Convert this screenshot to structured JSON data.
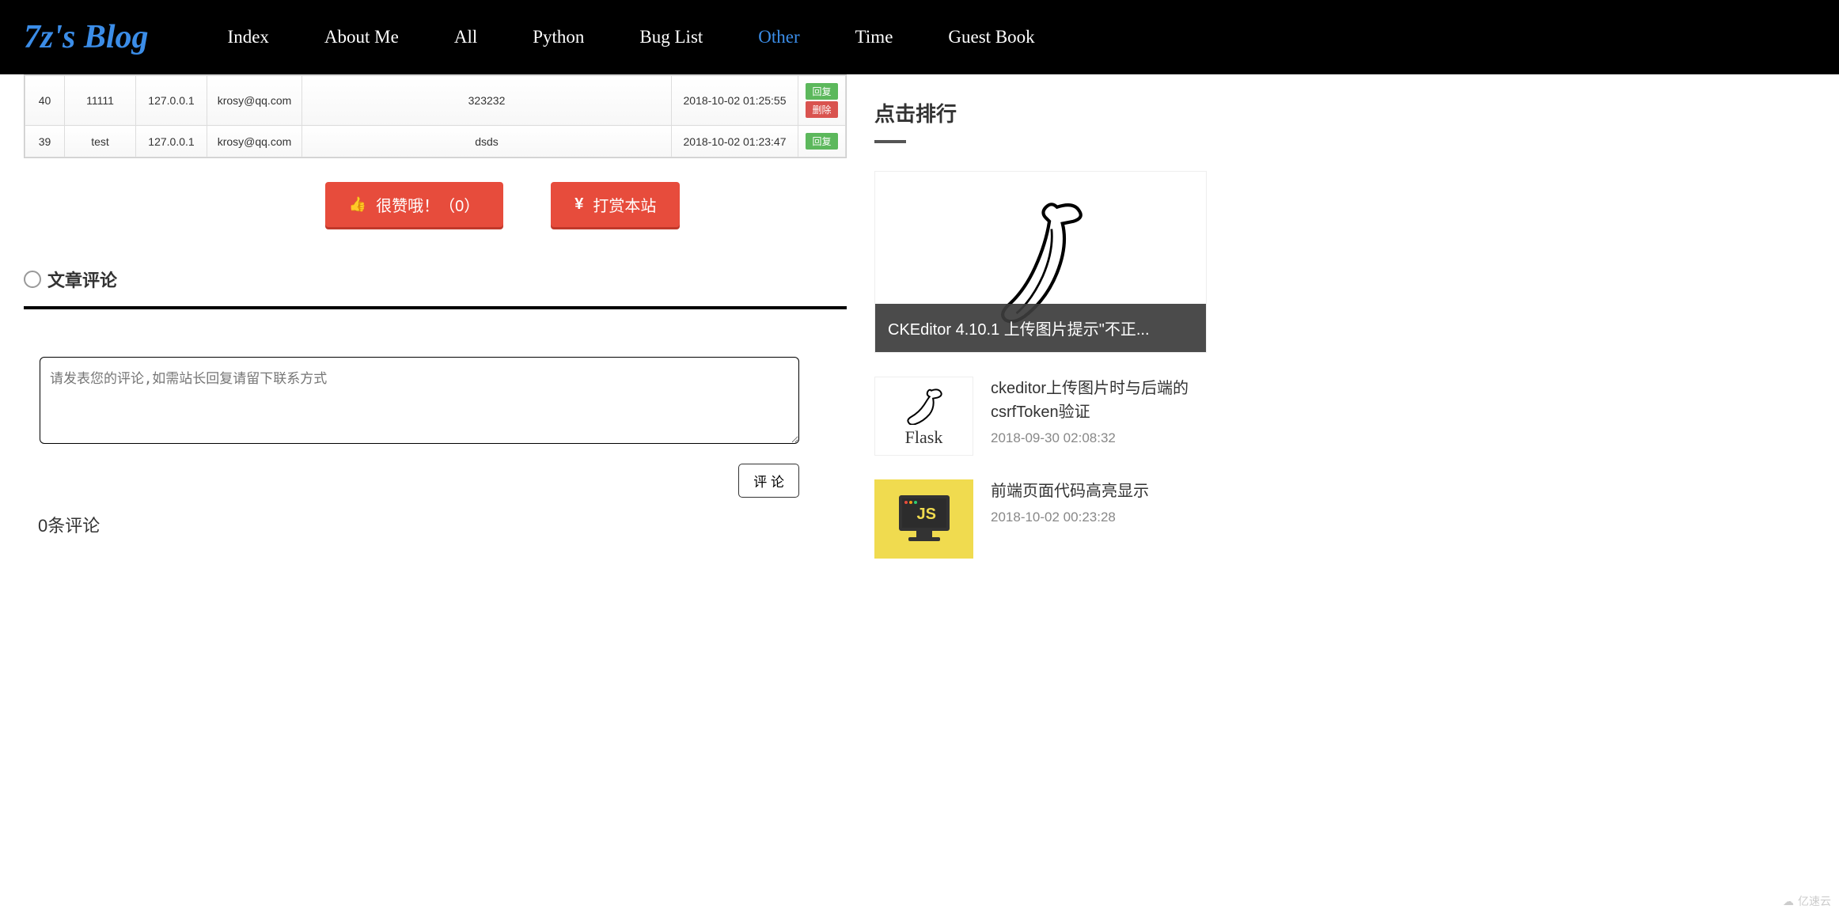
{
  "header": {
    "logo": "7z's Blog",
    "nav": [
      {
        "label": "Index",
        "active": false
      },
      {
        "label": "About Me",
        "active": false
      },
      {
        "label": "All",
        "active": false
      },
      {
        "label": "Python",
        "active": false
      },
      {
        "label": "Bug List",
        "active": false
      },
      {
        "label": "Other",
        "active": true
      },
      {
        "label": "Time",
        "active": false
      },
      {
        "label": "Guest Book",
        "active": false
      }
    ]
  },
  "table": {
    "rows": [
      {
        "id": "40",
        "name": "11111",
        "ip": "127.0.0.1",
        "email": "krosy@qq.com",
        "content": "323232",
        "time": "2018-10-02 01:25:55",
        "btn1": "回复",
        "btn2": "删除"
      },
      {
        "id": "39",
        "name": "test",
        "ip": "127.0.0.1",
        "email": "krosy@qq.com",
        "content": "dsds",
        "time": "2018-10-02 01:23:47",
        "btn1": "回复",
        "btn2": ""
      }
    ]
  },
  "actions": {
    "like_label": "很赞哦！（0）",
    "donate_label": "打赏本站"
  },
  "comments": {
    "section_title": "文章评论",
    "placeholder": "请发表您的评论,如需站长回复请留下联系方式",
    "submit_label": "评 论",
    "count_label": "0条评论"
  },
  "sidebar": {
    "ranking_title": "点击排行",
    "featured": {
      "title": "CKEditor 4.10.1  上传图片提示\"不正..."
    },
    "posts": [
      {
        "title": "ckeditor上传图片时与后端的csrfToken验证",
        "date": "2018-09-30 02:08:32",
        "thumb": "flask",
        "thumb_label": "Flask"
      },
      {
        "title": "前端页面代码高亮显示",
        "date": "2018-10-02 00:23:28",
        "thumb": "js",
        "thumb_label": "JS"
      }
    ]
  },
  "watermark": "亿速云"
}
